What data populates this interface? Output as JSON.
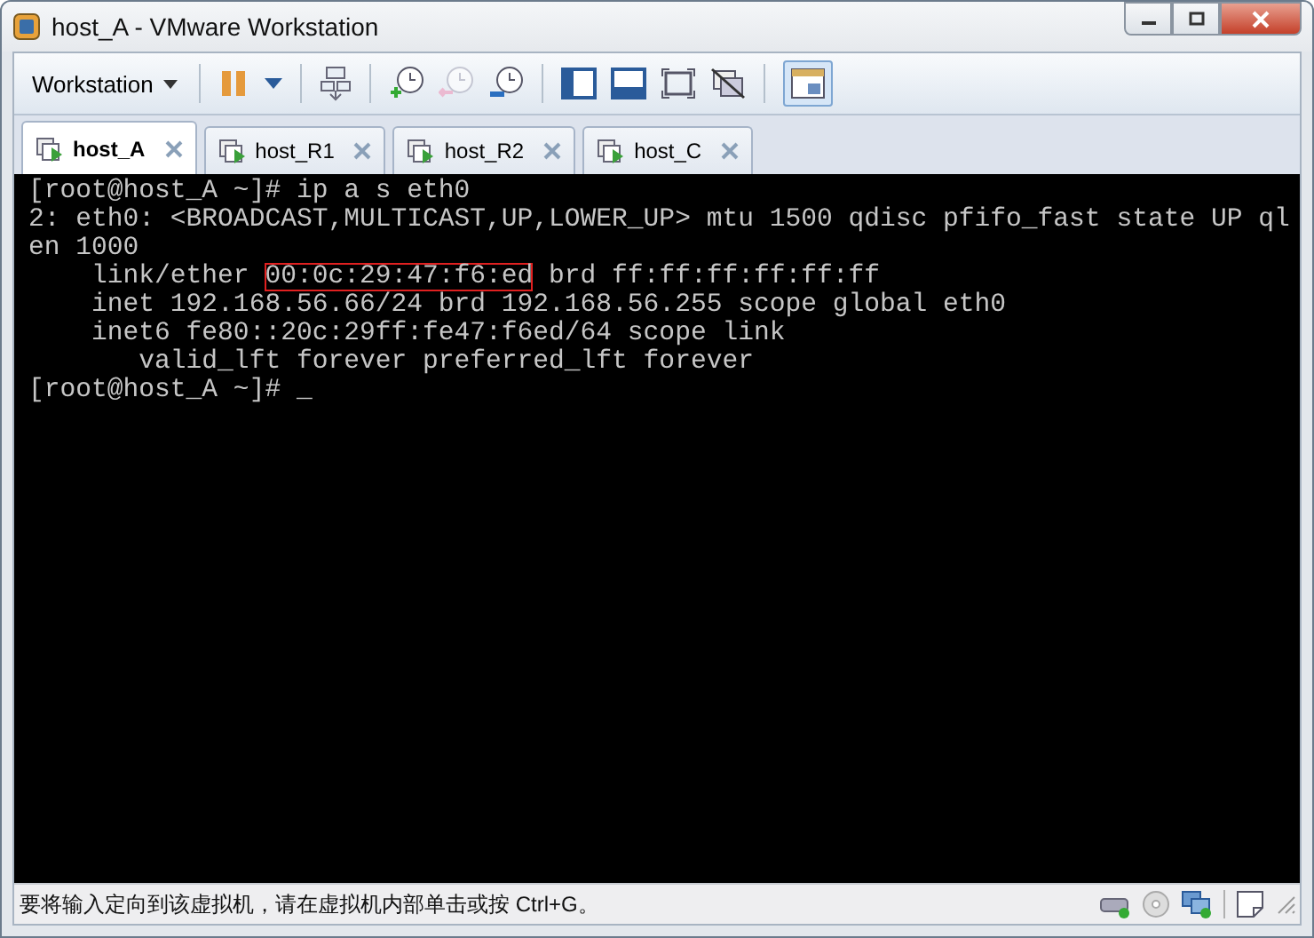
{
  "window": {
    "title": "host_A - VMware Workstation"
  },
  "toolbar": {
    "menu": "Workstation"
  },
  "tabs": [
    {
      "label": "host_A",
      "selected": true
    },
    {
      "label": "host_R1",
      "selected": false
    },
    {
      "label": "host_R2",
      "selected": false
    },
    {
      "label": "host_C",
      "selected": false
    }
  ],
  "terminal": {
    "lines": [
      [
        {
          "text": "[root@host_A ~]# ip a s eth0",
          "highlighted": false
        }
      ],
      [
        {
          "text": "2: eth0: <BROADCAST,MULTICAST,UP,LOWER_UP> mtu 1500 qdisc pfifo_fast state UP ql",
          "highlighted": false
        }
      ],
      [
        {
          "text": "en 1000",
          "highlighted": false
        }
      ],
      [
        {
          "text": "    link/ether ",
          "highlighted": false
        },
        {
          "text": "00:0c:29:47:f6:ed",
          "highlighted": true
        },
        {
          "text": " brd ff:ff:ff:ff:ff:ff",
          "highlighted": false
        }
      ],
      [
        {
          "text": "    inet 192.168.56.66/24 brd 192.168.56.255 scope global eth0",
          "highlighted": false
        }
      ],
      [
        {
          "text": "    inet6 fe80::20c:29ff:fe47:f6ed/64 scope link",
          "highlighted": false
        }
      ],
      [
        {
          "text": "       valid_lft forever preferred_lft forever",
          "highlighted": false
        }
      ],
      [
        {
          "text": "[root@host_A ~]# _",
          "highlighted": false
        }
      ]
    ]
  },
  "status_bar": {
    "message": "要将输入定向到该虚拟机，请在虚拟机内部单击或按 Ctrl+G。"
  }
}
